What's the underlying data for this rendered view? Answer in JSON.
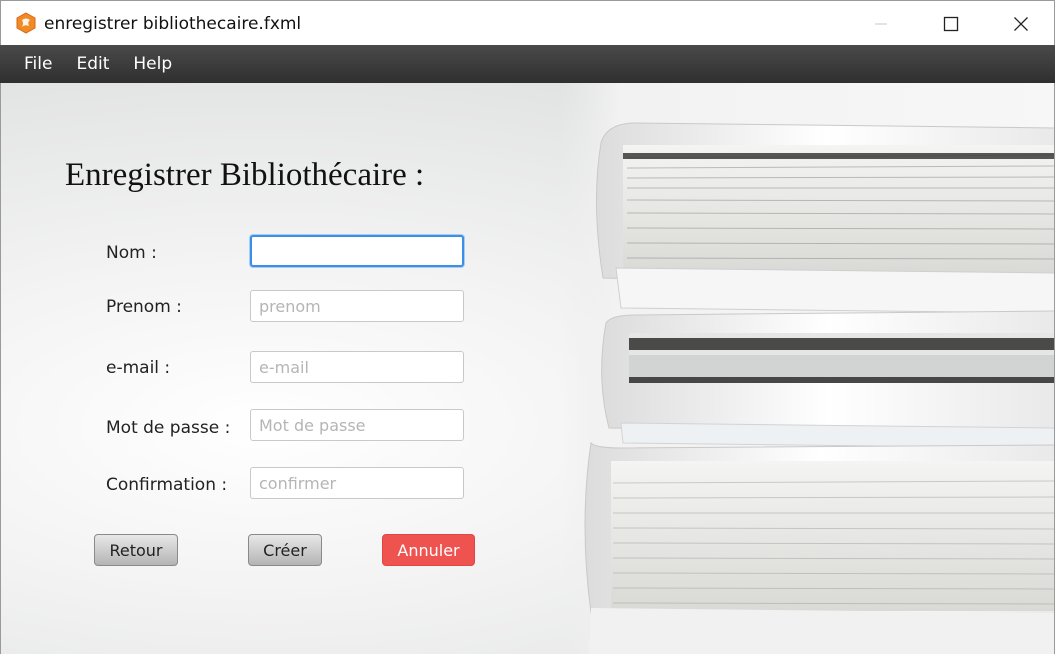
{
  "window": {
    "title": "enregistrer bibliothecaire.fxml",
    "icon": "java-app-icon"
  },
  "menu": {
    "items": [
      "File",
      "Edit",
      "Help"
    ]
  },
  "form": {
    "heading": "Enregistrer Bibliothécaire :",
    "fields": [
      {
        "label": "Nom :",
        "value": "",
        "placeholder": ""
      },
      {
        "label": "Prenom :",
        "value": "",
        "placeholder": "prenom"
      },
      {
        "label": "e-mail :",
        "value": "",
        "placeholder": "e-mail"
      },
      {
        "label": "Mot de passe :",
        "value": "",
        "placeholder": "Mot de passe"
      },
      {
        "label": "Confirmation :",
        "value": "",
        "placeholder": "confirmer"
      }
    ],
    "buttons": {
      "back": "Retour",
      "create": "Créer",
      "cancel": "Annuler"
    }
  },
  "colors": {
    "menubar": "#3a3a3a",
    "cancel_button": "#ef5350",
    "focus_ring": "#3a8fe6"
  }
}
